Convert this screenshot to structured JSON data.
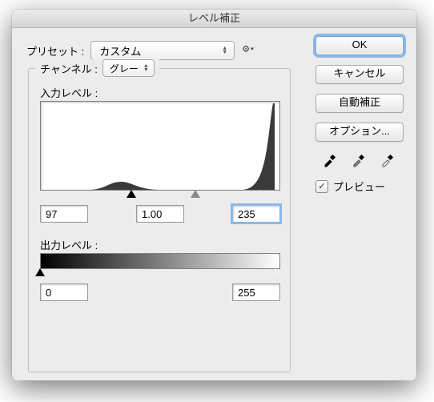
{
  "title": "レベル補正",
  "preset": {
    "label": "プリセット :",
    "value": "カスタム"
  },
  "channel": {
    "label": "チャンネル :",
    "value": "グレー"
  },
  "input": {
    "label": "入力レベル :",
    "shadow": "97",
    "mid": "1.00",
    "highlight": "235"
  },
  "output": {
    "label": "出力レベル :",
    "low": "0",
    "high": "255"
  },
  "buttons": {
    "ok": "OK",
    "cancel": "キャンセル",
    "auto": "自動補正",
    "options": "オプション..."
  },
  "preview": {
    "label": "プレビュー",
    "checked": true
  }
}
